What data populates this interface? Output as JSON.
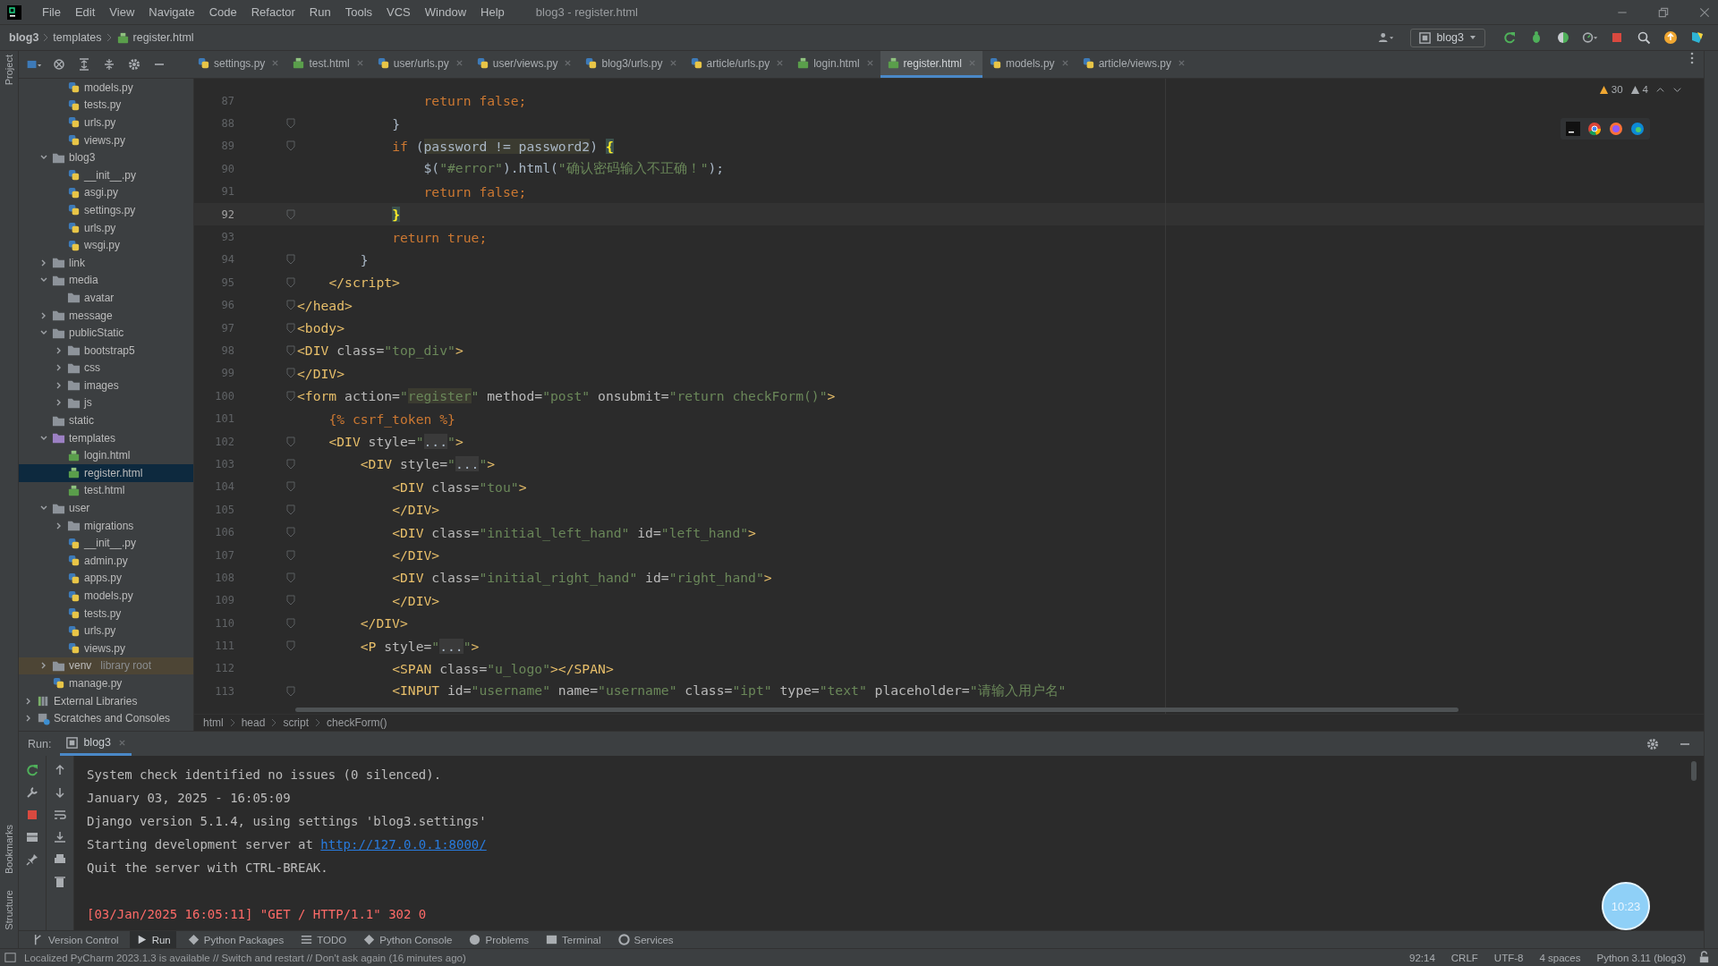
{
  "menu": {
    "items": [
      "File",
      "Edit",
      "View",
      "Navigate",
      "Code",
      "Refactor",
      "Run",
      "Tools",
      "VCS",
      "Window",
      "Help"
    ],
    "title": "blog3 - register.html"
  },
  "navigation": {
    "crumbs": [
      {
        "label": "blog3",
        "kind": "project"
      },
      {
        "label": "templates",
        "kind": "folder"
      },
      {
        "label": "register.html",
        "kind": "html"
      }
    ],
    "run_config": "blog3"
  },
  "side_labels": {
    "top": [
      "Project"
    ],
    "bottom": [
      "Bookmarks",
      "Structure"
    ]
  },
  "tabs": [
    {
      "label": "settings.py",
      "kind": "py",
      "selected": false
    },
    {
      "label": "test.html",
      "kind": "html",
      "selected": false
    },
    {
      "label": "user/urls.py",
      "kind": "py",
      "selected": false
    },
    {
      "label": "user/views.py",
      "kind": "py",
      "selected": false
    },
    {
      "label": "blog3/urls.py",
      "kind": "py",
      "selected": false
    },
    {
      "label": "article/urls.py",
      "kind": "py",
      "selected": false
    },
    {
      "label": "login.html",
      "kind": "html",
      "selected": false
    },
    {
      "label": "register.html",
      "kind": "html",
      "selected": true
    },
    {
      "label": "models.py",
      "kind": "py",
      "selected": false
    },
    {
      "label": "article/views.py",
      "kind": "py",
      "selected": false
    }
  ],
  "project_tree": [
    {
      "children": [
        {
          "children": [
            {
              "label": "models.py",
              "kind": "py",
              "selected": false
            },
            {
              "label": "tests.py",
              "kind": "py",
              "selected": false
            },
            {
              "label": "urls.py",
              "kind": "py",
              "selected": false
            },
            {
              "label": "views.py",
              "kind": "py",
              "selected": false
            }
          ]
        },
        {
          "label": "blog3",
          "kind": "folder",
          "expanded": true,
          "selected": false,
          "children": [
            {
              "label": "__init__.py",
              "kind": "py",
              "selected": false
            },
            {
              "label": "asgi.py",
              "kind": "py",
              "selected": false
            },
            {
              "label": "settings.py",
              "kind": "py",
              "selected": false
            },
            {
              "label": "urls.py",
              "kind": "py",
              "selected": false
            },
            {
              "label": "wsgi.py",
              "kind": "py",
              "selected": false
            }
          ]
        },
        {
          "label": "link",
          "kind": "folder",
          "expanded": false,
          "selected": false
        },
        {
          "label": "media",
          "kind": "folder",
          "expanded": true,
          "selected": false,
          "children": [
            {
              "label": "avatar",
              "kind": "folder",
              "selected": false
            }
          ]
        },
        {
          "label": "message",
          "kind": "folder",
          "expanded": false,
          "selected": false
        },
        {
          "label": "publicStatic",
          "kind": "folder",
          "expanded": true,
          "selected": false,
          "children": [
            {
              "label": "bootstrap5",
              "kind": "folder",
              "expanded": false,
              "selected": false
            },
            {
              "label": "css",
              "kind": "folder",
              "expanded": false,
              "selected": false
            },
            {
              "label": "images",
              "kind": "folder",
              "expanded": false,
              "selected": false
            },
            {
              "label": "js",
              "kind": "folder",
              "expanded": false,
              "selected": false
            }
          ]
        },
        {
          "label": "static",
          "kind": "folder",
          "selected": false
        },
        {
          "label": "templates",
          "kind": "templates",
          "expanded": true,
          "selected": false,
          "children": [
            {
              "label": "login.html",
              "kind": "html",
              "selected": false
            },
            {
              "label": "register.html",
              "kind": "html",
              "selected": true
            },
            {
              "label": "test.html",
              "kind": "html",
              "selected": false
            }
          ]
        },
        {
          "label": "user",
          "kind": "folder",
          "expanded": true,
          "selected": false,
          "children": [
            {
              "label": "migrations",
              "kind": "folder",
              "expanded": false,
              "selected": false
            },
            {
              "label": "__init__.py",
              "kind": "py",
              "selected": false
            },
            {
              "label": "admin.py",
              "kind": "py",
              "selected": false
            },
            {
              "label": "apps.py",
              "kind": "py",
              "selected": false
            },
            {
              "label": "models.py",
              "kind": "py",
              "selected": false
            },
            {
              "label": "tests.py",
              "kind": "py",
              "selected": false
            },
            {
              "label": "urls.py",
              "kind": "py",
              "selected": false
            },
            {
              "label": "views.py",
              "kind": "py",
              "selected": false
            }
          ]
        },
        {
          "label": "venv",
          "kind": "venv",
          "note": "library root",
          "expanded": false,
          "selected": false
        },
        {
          "label": "manage.py",
          "kind": "py",
          "selected": false
        }
      ]
    },
    {
      "label": "External Libraries",
      "kind": "library",
      "expanded": false,
      "selected": false
    },
    {
      "label": "Scratches and Consoles",
      "kind": "scratch",
      "expanded": false,
      "selected": false
    }
  ],
  "editor": {
    "inspections": {
      "warnings": "30",
      "weak_warnings": "4"
    },
    "lines": [
      {
        "num": "87",
        "current": false,
        "fold": false,
        "tokens": [
          {
            "kind": "kw",
            "text": "                return false;"
          }
        ]
      },
      {
        "num": "88",
        "current": false,
        "fold": true,
        "tokens": [
          {
            "kind": "plain",
            "text": "            }"
          }
        ]
      },
      {
        "num": "89",
        "current": false,
        "fold": true,
        "tokens": [
          {
            "kind": "kw",
            "text": "            if "
          },
          {
            "kind": "plain",
            "text": "("
          },
          {
            "kind": "hl",
            "text": "password != password2"
          },
          {
            "kind": "plain",
            "text": ") "
          },
          {
            "kind": "match",
            "text": "{"
          }
        ]
      },
      {
        "num": "90",
        "current": false,
        "fold": false,
        "tokens": [
          {
            "kind": "plain",
            "text": "                $("
          },
          {
            "kind": "str",
            "text": "\"#error\""
          },
          {
            "kind": "plain",
            "text": ").html("
          },
          {
            "kind": "str",
            "text": "\"确认密码输入不正确！\""
          },
          {
            "kind": "plain",
            "text": ");"
          }
        ]
      },
      {
        "num": "91",
        "current": false,
        "fold": false,
        "tokens": [
          {
            "kind": "kw",
            "text": "                return false;"
          }
        ]
      },
      {
        "num": "92",
        "current": true,
        "fold": true,
        "tokens": [
          {
            "kind": "match",
            "text": "            }"
          }
        ]
      },
      {
        "num": "93",
        "current": false,
        "fold": false,
        "tokens": [
          {
            "kind": "kw",
            "text": "            return true;"
          }
        ]
      },
      {
        "num": "94",
        "current": false,
        "fold": true,
        "tokens": [
          {
            "kind": "plain",
            "text": "        }"
          }
        ]
      },
      {
        "num": "95",
        "current": false,
        "fold": true,
        "tokens": [
          {
            "kind": "tag",
            "text": "    </script>"
          }
        ]
      },
      {
        "num": "96",
        "current": false,
        "fold": true,
        "tokens": [
          {
            "kind": "tag",
            "text": "</head>"
          }
        ]
      },
      {
        "num": "97",
        "current": false,
        "fold": true,
        "tokens": [
          {
            "kind": "tag",
            "text": "<body>"
          }
        ]
      },
      {
        "num": "98",
        "current": false,
        "fold": true,
        "tokens": [
          {
            "kind": "tag",
            "text": "<DIV"
          },
          {
            "kind": "attr",
            "text": " class="
          },
          {
            "kind": "str",
            "text": "\"top_div\""
          },
          {
            "kind": "tag",
            "text": ">"
          }
        ]
      },
      {
        "num": "99",
        "current": false,
        "fold": true,
        "tokens": [
          {
            "kind": "tag",
            "text": "</DIV>"
          }
        ]
      },
      {
        "num": "100",
        "current": false,
        "fold": true,
        "tokens": [
          {
            "kind": "tag",
            "text": "<form"
          },
          {
            "kind": "attr",
            "text": " action="
          },
          {
            "kind": "str",
            "text": "\""
          },
          {
            "kind": "strhl",
            "text": "register"
          },
          {
            "kind": "str",
            "text": "\""
          },
          {
            "kind": "attr",
            "text": " method="
          },
          {
            "kind": "str",
            "text": "\"post\""
          },
          {
            "kind": "attr",
            "text": " onsubmit="
          },
          {
            "kind": "str",
            "text": "\"return checkForm()\""
          },
          {
            "kind": "tag",
            "text": ">"
          }
        ]
      },
      {
        "num": "101",
        "current": false,
        "fold": false,
        "tokens": [
          {
            "kind": "tpl",
            "text": "    {% csrf_token %}"
          }
        ]
      },
      {
        "num": "102",
        "current": false,
        "fold": true,
        "tokens": [
          {
            "kind": "tag",
            "text": "    <DIV"
          },
          {
            "kind": "attr",
            "text": " style="
          },
          {
            "kind": "str",
            "text": "\""
          },
          {
            "kind": "folded",
            "text": "..."
          },
          {
            "kind": "str",
            "text": "\""
          },
          {
            "kind": "tag",
            "text": ">"
          }
        ]
      },
      {
        "num": "103",
        "current": false,
        "fold": true,
        "tokens": [
          {
            "kind": "tag",
            "text": "        <DIV"
          },
          {
            "kind": "attr",
            "text": " style="
          },
          {
            "kind": "str",
            "text": "\""
          },
          {
            "kind": "folded",
            "text": "..."
          },
          {
            "kind": "str",
            "text": "\""
          },
          {
            "kind": "tag",
            "text": ">"
          }
        ]
      },
      {
        "num": "104",
        "current": false,
        "fold": true,
        "tokens": [
          {
            "kind": "tag",
            "text": "            <DIV"
          },
          {
            "kind": "attr",
            "text": " class="
          },
          {
            "kind": "str",
            "text": "\"tou\""
          },
          {
            "kind": "tag",
            "text": ">"
          }
        ]
      },
      {
        "num": "105",
        "current": false,
        "fold": true,
        "tokens": [
          {
            "kind": "tag",
            "text": "            </DIV>"
          }
        ]
      },
      {
        "num": "106",
        "current": false,
        "fold": true,
        "tokens": [
          {
            "kind": "tag",
            "text": "            <DIV"
          },
          {
            "kind": "attr",
            "text": " class="
          },
          {
            "kind": "str",
            "text": "\"initial_left_hand\""
          },
          {
            "kind": "attr",
            "text": " id="
          },
          {
            "kind": "str",
            "text": "\"left_hand\""
          },
          {
            "kind": "tag",
            "text": ">"
          }
        ]
      },
      {
        "num": "107",
        "current": false,
        "fold": true,
        "tokens": [
          {
            "kind": "tag",
            "text": "            </DIV>"
          }
        ]
      },
      {
        "num": "108",
        "current": false,
        "fold": true,
        "tokens": [
          {
            "kind": "tag",
            "text": "            <DIV"
          },
          {
            "kind": "attr",
            "text": " class="
          },
          {
            "kind": "str",
            "text": "\"initial_right_hand\""
          },
          {
            "kind": "attr",
            "text": " id="
          },
          {
            "kind": "str",
            "text": "\"right_hand\""
          },
          {
            "kind": "tag",
            "text": ">"
          }
        ]
      },
      {
        "num": "109",
        "current": false,
        "fold": true,
        "tokens": [
          {
            "kind": "tag",
            "text": "            </DIV>"
          }
        ]
      },
      {
        "num": "110",
        "current": false,
        "fold": true,
        "tokens": [
          {
            "kind": "tag",
            "text": "        </DIV>"
          }
        ]
      },
      {
        "num": "111",
        "current": false,
        "fold": true,
        "tokens": [
          {
            "kind": "tag",
            "text": "        <P"
          },
          {
            "kind": "attr",
            "text": " style="
          },
          {
            "kind": "str",
            "text": "\""
          },
          {
            "kind": "folded",
            "text": "..."
          },
          {
            "kind": "str",
            "text": "\""
          },
          {
            "kind": "tag",
            "text": ">"
          }
        ]
      },
      {
        "num": "112",
        "current": false,
        "fold": false,
        "tokens": [
          {
            "kind": "tag",
            "text": "            <SPAN"
          },
          {
            "kind": "attr",
            "text": " class="
          },
          {
            "kind": "str",
            "text": "\"u_logo\""
          },
          {
            "kind": "tag",
            "text": "></SPAN>"
          }
        ]
      },
      {
        "num": "113",
        "current": false,
        "fold": true,
        "tokens": [
          {
            "kind": "tag",
            "text": "            <INPUT"
          },
          {
            "kind": "attr",
            "text": " id="
          },
          {
            "kind": "str",
            "text": "\"username\""
          },
          {
            "kind": "attr",
            "text": " name="
          },
          {
            "kind": "str",
            "text": "\"username\""
          },
          {
            "kind": "attr",
            "text": " class="
          },
          {
            "kind": "str",
            "text": "\"ipt\""
          },
          {
            "kind": "attr",
            "text": " type="
          },
          {
            "kind": "str",
            "text": "\"text\""
          },
          {
            "kind": "attr",
            "text": " placeholder="
          },
          {
            "kind": "str",
            "text": "\"请输入用户名\""
          }
        ]
      }
    ],
    "breadcrumb": [
      "html",
      "head",
      "script",
      "checkForm()"
    ]
  },
  "run_panel": {
    "label": "Run:",
    "tab": "blog3",
    "console": [
      {
        "kind": "plain",
        "parts": [
          {
            "kind": "text",
            "text": "System check identified no issues (0 silenced)."
          }
        ]
      },
      {
        "kind": "plain",
        "parts": [
          {
            "kind": "text",
            "text": "January 03, 2025 - 16:05:09"
          }
        ]
      },
      {
        "kind": "plain",
        "parts": [
          {
            "kind": "text",
            "text": "Django version 5.1.4, using settings 'blog3.settings'"
          }
        ]
      },
      {
        "kind": "plain",
        "parts": [
          {
            "kind": "text",
            "text": "Starting development server at "
          },
          {
            "kind": "link",
            "text": "http://127.0.0.1:8000/"
          }
        ]
      },
      {
        "kind": "plain",
        "parts": [
          {
            "kind": "text",
            "text": "Quit the server with CTRL-BREAK."
          }
        ]
      },
      {
        "kind": "error",
        "parts": [
          {
            "kind": "text",
            "text": "[03/Jan/2025 16:05:11] \"GET / HTTP/1.1\" 302 0"
          }
        ]
      }
    ]
  },
  "tool_tabs": [
    {
      "label": "Version Control",
      "kind": "vcs",
      "selected": false
    },
    {
      "label": "Run",
      "kind": "run",
      "selected": true
    },
    {
      "label": "Python Packages",
      "kind": "packages",
      "selected": false
    },
    {
      "label": "TODO",
      "kind": "todo",
      "selected": false
    },
    {
      "label": "Python Console",
      "kind": "console",
      "selected": false
    },
    {
      "label": "Problems",
      "kind": "problems",
      "selected": false
    },
    {
      "label": "Terminal",
      "kind": "terminal",
      "selected": false
    },
    {
      "label": "Services",
      "kind": "services",
      "selected": false
    }
  ],
  "timer": "10:23",
  "status_bar": {
    "message": "Localized PyCharm 2023.1.3 is available // Switch and restart // Don't ask again (16 minutes ago)",
    "items": [
      "92:14",
      "CRLF",
      "UTF-8",
      "4 spaces",
      "Python 3.11 (blog3)"
    ]
  }
}
